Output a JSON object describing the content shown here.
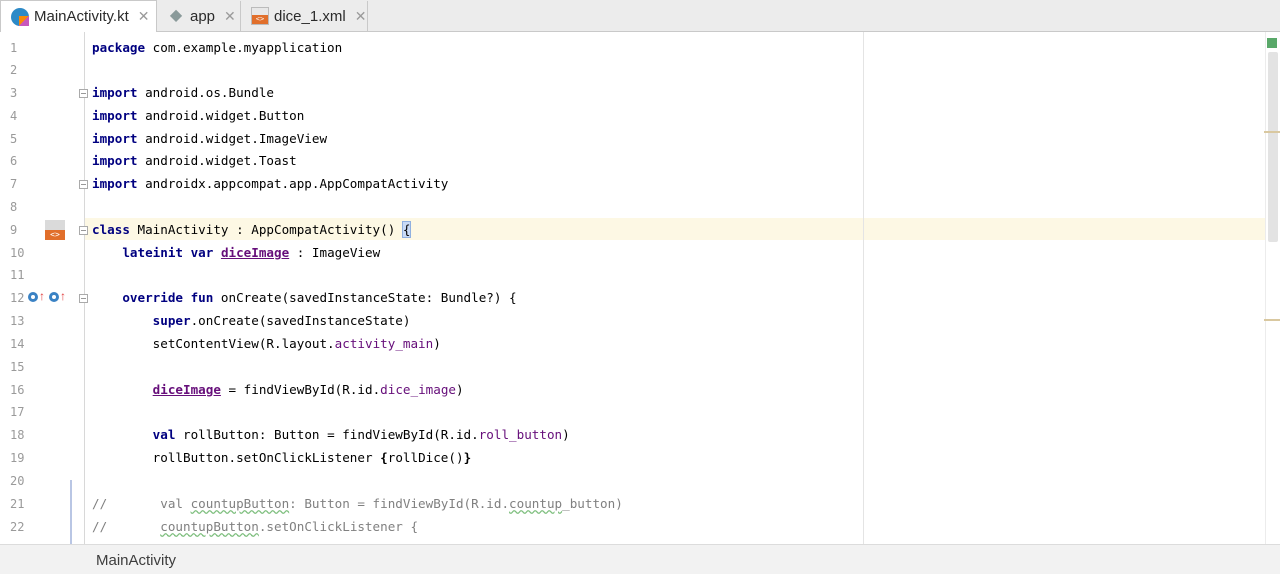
{
  "tabs": [
    {
      "label": "MainActivity.kt",
      "icon": "kotlin-file-icon",
      "active": true
    },
    {
      "label": "app",
      "icon": "android-module-icon",
      "active": false
    },
    {
      "label": "dice_1.xml",
      "icon": "xml-file-icon",
      "active": false
    }
  ],
  "tab_close_glyph": "✕",
  "editor": {
    "line_numbers": [
      "1",
      "2",
      "3",
      "4",
      "5",
      "6",
      "7",
      "8",
      "9",
      "10",
      "11",
      "12",
      "13",
      "14",
      "15",
      "16",
      "17",
      "18",
      "19",
      "20",
      "21",
      "22"
    ],
    "code": {
      "l1_kw": "package",
      "l1_rest": " com.example.myapplication",
      "l3_kw": "import",
      "l3_rest": " android.os.Bundle",
      "l4_kw": "import",
      "l4_rest": " android.widget.Button",
      "l5_kw": "import",
      "l5_rest": " android.widget.ImageView",
      "l6_kw": "import",
      "l6_rest": " android.widget.Toast",
      "l7_kw": "import",
      "l7_rest": " androidx.appcompat.app.AppCompatActivity",
      "l9_kw": "class",
      "l9_rest": " MainActivity : AppCompatActivity() ",
      "l9_brace": "{",
      "l10_indent": "    ",
      "l10_kw": "lateinit var",
      "l10_sp": " ",
      "l10_prop": "diceImage",
      "l10_rest": " : ImageView",
      "l12_indent": "    ",
      "l12_kw": "override fun",
      "l12_rest": " onCreate(savedInstanceState: Bundle?) {",
      "l13_indent": "        ",
      "l13_kw": "super",
      "l13_rest": ".onCreate(savedInstanceState)",
      "l14_indent": "        ",
      "l14_pre": "setContentView(R.layout.",
      "l14_prop": "activity_main",
      "l14_post": ")",
      "l16_indent": "        ",
      "l16_prop": "diceImage",
      "l16_pre": " = findViewById(R.id.",
      "l16_id": "dice_image",
      "l16_post": ")",
      "l18_indent": "        ",
      "l18_kw": "val",
      "l18_pre": " rollButton: Button = findViewById(R.id.",
      "l18_id": "roll_button",
      "l18_post": ")",
      "l19_indent": "        ",
      "l19_pre": "rollButton.setOnClickListener ",
      "l19_bold": "{",
      "l19_mid": "rollDice()",
      "l19_bold2": "}",
      "l21_a": "//       val ",
      "l21_typo": "countupButton",
      "l21_b": ": Button = findViewById(R.id.",
      "l21_typo2": "countup",
      "l21_c": "_button)",
      "l22_a": "//       ",
      "l22_typo": "countupButton",
      "l22_b": ".setOnClickListener {"
    }
  },
  "gutter_icons": {
    "line9": "xml-layout-icon",
    "line12_a": "overrides-method-icon",
    "line12_b": "overrides-method-icon"
  },
  "breadcrumb": {
    "label": "MainActivity"
  },
  "colors": {
    "keyword": "#000080",
    "property": "#660e7a",
    "comment": "#808080",
    "caret_row": "#fdf8e4"
  }
}
